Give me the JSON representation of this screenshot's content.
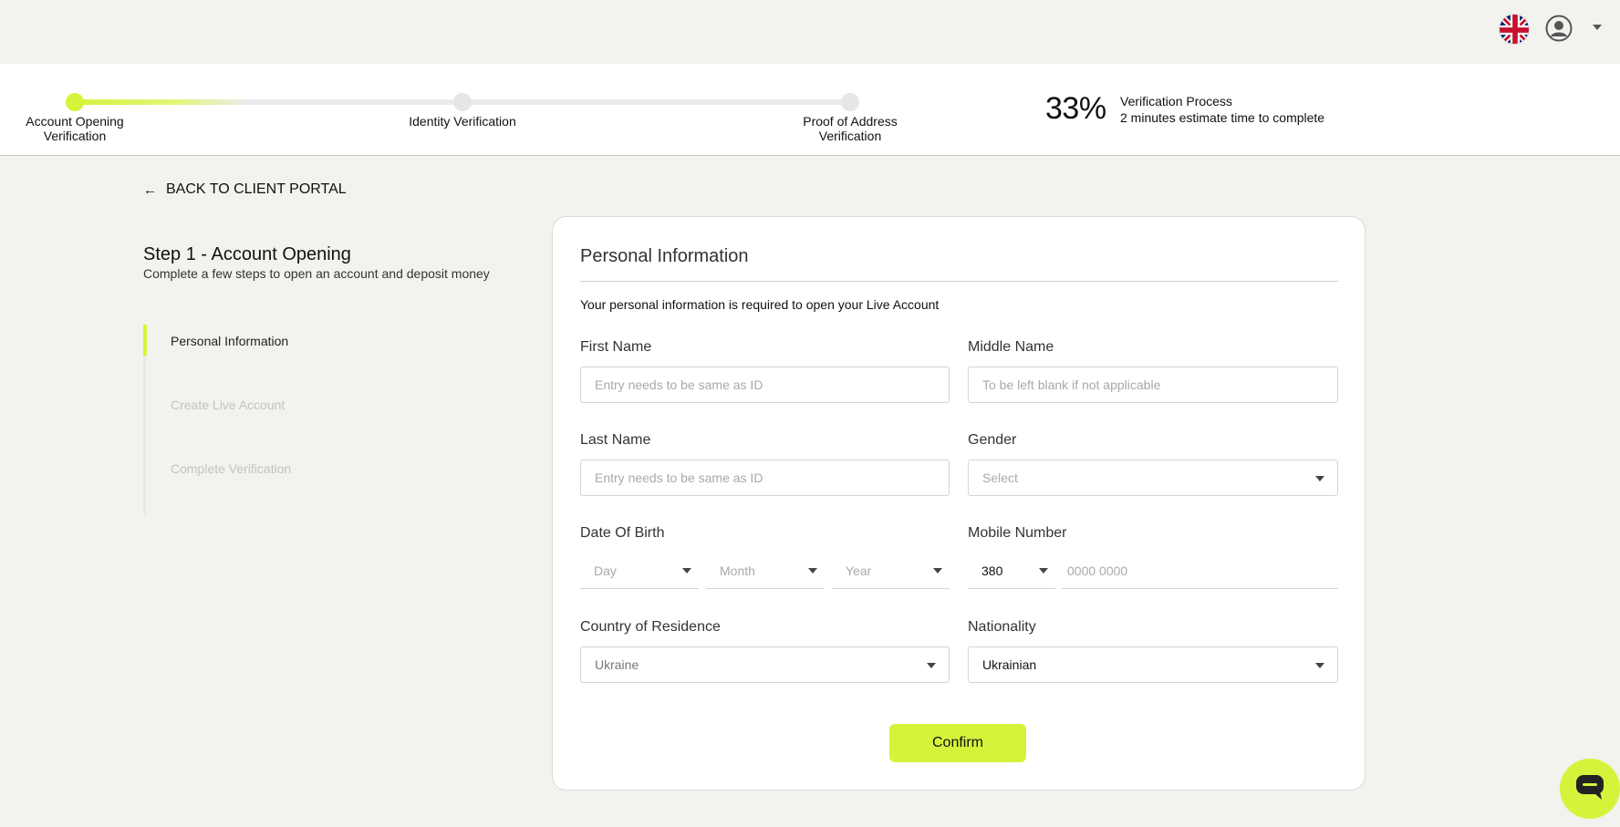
{
  "topbar": {
    "language_icon": "uk-flag-icon",
    "user_icon": "user-avatar-icon",
    "menu_icon": "chevron-down-icon"
  },
  "progress": {
    "steps": [
      {
        "label": "Account Opening Verification",
        "status": "active"
      },
      {
        "label": "Identity Verification",
        "status": "pending"
      },
      {
        "label": "Proof of Address Verification",
        "status": "pending"
      }
    ],
    "percent": "33%",
    "title": "Verification Process",
    "subtitle": "2 minutes estimate time to complete"
  },
  "back_link": "BACK TO CLIENT PORTAL",
  "sidebar": {
    "title": "Step 1 - Account Opening",
    "subtitle": "Complete a few steps to open an account and deposit money",
    "items": [
      {
        "label": "Personal Information",
        "status": "active"
      },
      {
        "label": "Create Live Account",
        "status": "inactive"
      },
      {
        "label": "Complete Verification",
        "status": "inactive"
      }
    ]
  },
  "form": {
    "title": "Personal Information",
    "description": "Your personal information is required to open your Live Account",
    "first_name": {
      "label": "First Name",
      "placeholder": "Entry needs to be same as ID"
    },
    "middle_name": {
      "label": "Middle Name",
      "placeholder": "To be left blank if not applicable"
    },
    "last_name": {
      "label": "Last Name",
      "placeholder": "Entry needs to be same as ID"
    },
    "gender": {
      "label": "Gender",
      "placeholder": "Select"
    },
    "dob": {
      "label": "Date Of Birth",
      "day": "Day",
      "month": "Month",
      "year": "Year"
    },
    "mobile": {
      "label": "Mobile Number",
      "code": "380",
      "placeholder": "0000 0000"
    },
    "country": {
      "label": "Country of Residence",
      "value": "Ukraine"
    },
    "nationality": {
      "label": "Nationality",
      "value": "Ukrainian"
    },
    "confirm_label": "Confirm"
  },
  "colors": {
    "accent": "#d4f43b",
    "background": "#f2f2ee"
  }
}
